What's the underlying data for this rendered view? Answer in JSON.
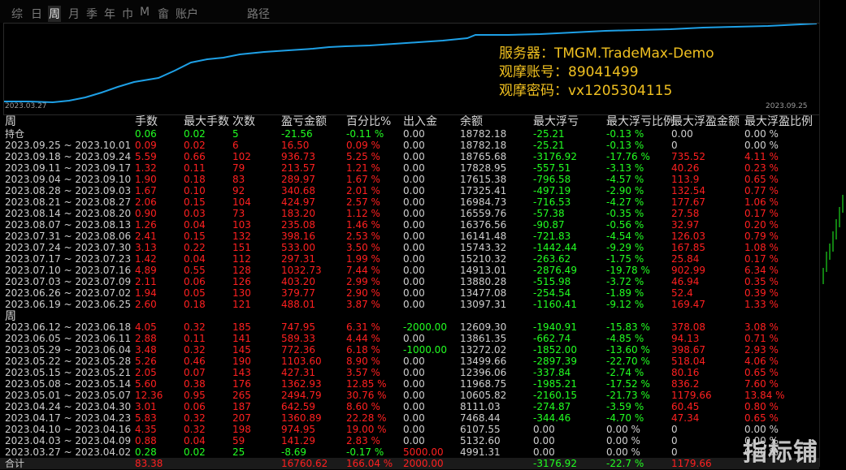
{
  "tabs": [
    {
      "label": "综",
      "active": false
    },
    {
      "label": "日",
      "active": false
    },
    {
      "label": "周",
      "active": true
    },
    {
      "label": "月",
      "active": false
    },
    {
      "label": "季",
      "active": false
    },
    {
      "label": "年",
      "active": false
    },
    {
      "label": "巾",
      "active": false
    },
    {
      "label": "M",
      "active": false
    },
    {
      "label": "畲",
      "active": false
    },
    {
      "label": "账户",
      "active": false
    },
    {
      "label": "路径",
      "active": false
    }
  ],
  "info": {
    "server": "服务器：TMGM.TradeMax-Demo",
    "account": "观摩账号：89041499",
    "password": "观摩密码：vx1205304115"
  },
  "curve": {
    "start_date": "2023.03.27",
    "end_date": "2023.09.25"
  },
  "headers": [
    "周",
    "手数",
    "最大手数",
    "次数",
    "盈亏金额",
    "百分比%",
    "出入金",
    "余额",
    "最大浮亏",
    "最大浮亏比例",
    "最大浮盈金额",
    "最大浮盈比例"
  ],
  "position_row": {
    "label": "持仓",
    "lots": "0.06",
    "max_lots": "0.02",
    "count": "5",
    "pnl": "-21.56",
    "pct": "-0.11 %",
    "inout": "0.00",
    "balance": "18782.18",
    "max_dd": "-25.21",
    "max_dd_pct": "-0.13 %",
    "max_fp": "0.00",
    "max_fp_pct": "0.00 %"
  },
  "rows": [
    {
      "period": "2023.09.25 ~ 2023.10.01",
      "lots": "0.09",
      "max_lots": "0.02",
      "count": "6",
      "pnl": "16.50",
      "pct": "0.09 %",
      "inout": "0.00",
      "balance": "18782.18",
      "max_dd": "-25.21",
      "max_dd_pct": "-0.13 %",
      "max_fp": "0",
      "max_fp_pct": "0.00 %"
    },
    {
      "period": "2023.09.18 ~ 2023.09.24",
      "lots": "5.59",
      "max_lots": "0.66",
      "count": "102",
      "pnl": "936.73",
      "pct": "5.25 %",
      "inout": "0.00",
      "balance": "18765.68",
      "max_dd": "-3176.92",
      "max_dd_pct": "-17.76 %",
      "max_fp": "735.52",
      "max_fp_pct": "4.11 %"
    },
    {
      "period": "2023.09.11 ~ 2023.09.17",
      "lots": "1.32",
      "max_lots": "0.11",
      "count": "79",
      "pnl": "213.57",
      "pct": "1.21 %",
      "inout": "0.00",
      "balance": "17828.95",
      "max_dd": "-557.51",
      "max_dd_pct": "-3.13 %",
      "max_fp": "40.26",
      "max_fp_pct": "0.23 %"
    },
    {
      "period": "2023.09.04 ~ 2023.09.10",
      "lots": "1.90",
      "max_lots": "0.18",
      "count": "83",
      "pnl": "289.97",
      "pct": "1.67 %",
      "inout": "0.00",
      "balance": "17615.38",
      "max_dd": "-796.58",
      "max_dd_pct": "-4.57 %",
      "max_fp": "113.9",
      "max_fp_pct": "0.65 %"
    },
    {
      "period": "2023.08.28 ~ 2023.09.03",
      "lots": "1.67",
      "max_lots": "0.10",
      "count": "92",
      "pnl": "340.68",
      "pct": "2.01 %",
      "inout": "0.00",
      "balance": "17325.41",
      "max_dd": "-497.19",
      "max_dd_pct": "-2.90 %",
      "max_fp": "132.54",
      "max_fp_pct": "0.77 %"
    },
    {
      "period": "2023.08.21 ~ 2023.08.27",
      "lots": "2.06",
      "max_lots": "0.15",
      "count": "104",
      "pnl": "424.97",
      "pct": "2.57 %",
      "inout": "0.00",
      "balance": "16984.73",
      "max_dd": "-716.53",
      "max_dd_pct": "-4.27 %",
      "max_fp": "177.67",
      "max_fp_pct": "1.06 %"
    },
    {
      "period": "2023.08.14 ~ 2023.08.20",
      "lots": "0.90",
      "max_lots": "0.03",
      "count": "73",
      "pnl": "183.20",
      "pct": "1.12 %",
      "inout": "0.00",
      "balance": "16559.76",
      "max_dd": "-57.38",
      "max_dd_pct": "-0.35 %",
      "max_fp": "27.58",
      "max_fp_pct": "0.17 %"
    },
    {
      "period": "2023.08.07 ~ 2023.08.13",
      "lots": "1.26",
      "max_lots": "0.04",
      "count": "103",
      "pnl": "235.08",
      "pct": "1.46 %",
      "inout": "0.00",
      "balance": "16376.56",
      "max_dd": "-90.87",
      "max_dd_pct": "-0.56 %",
      "max_fp": "32.97",
      "max_fp_pct": "0.20 %"
    },
    {
      "period": "2023.07.31 ~ 2023.08.06",
      "lots": "2.41",
      "max_lots": "0.15",
      "count": "132",
      "pnl": "398.16",
      "pct": "2.53 %",
      "inout": "0.00",
      "balance": "16141.48",
      "max_dd": "-721.83",
      "max_dd_pct": "-4.54 %",
      "max_fp": "126.03",
      "max_fp_pct": "0.79 %"
    },
    {
      "period": "2023.07.24 ~ 2023.07.30",
      "lots": "3.13",
      "max_lots": "0.22",
      "count": "151",
      "pnl": "533.00",
      "pct": "3.50 %",
      "inout": "0.00",
      "balance": "15743.32",
      "max_dd": "-1442.44",
      "max_dd_pct": "-9.29 %",
      "max_fp": "167.85",
      "max_fp_pct": "1.08 %"
    },
    {
      "period": "2023.07.17 ~ 2023.07.23",
      "lots": "1.42",
      "max_lots": "0.04",
      "count": "112",
      "pnl": "297.31",
      "pct": "1.99 %",
      "inout": "0.00",
      "balance": "15210.32",
      "max_dd": "-263.62",
      "max_dd_pct": "-1.75 %",
      "max_fp": "25.84",
      "max_fp_pct": "0.17 %"
    },
    {
      "period": "2023.07.10 ~ 2023.07.16",
      "lots": "4.89",
      "max_lots": "0.55",
      "count": "128",
      "pnl": "1032.73",
      "pct": "7.44 %",
      "inout": "0.00",
      "balance": "14913.01",
      "max_dd": "-2876.49",
      "max_dd_pct": "-19.78 %",
      "max_fp": "902.99",
      "max_fp_pct": "6.34 %"
    },
    {
      "period": "2023.07.03 ~ 2023.07.09",
      "lots": "2.11",
      "max_lots": "0.06",
      "count": "126",
      "pnl": "403.20",
      "pct": "2.99 %",
      "inout": "0.00",
      "balance": "13880.28",
      "max_dd": "-515.98",
      "max_dd_pct": "-3.72 %",
      "max_fp": "46.94",
      "max_fp_pct": "0.35 %"
    },
    {
      "period": "2023.06.26 ~ 2023.07.02",
      "lots": "1.94",
      "max_lots": "0.05",
      "count": "130",
      "pnl": "379.77",
      "pct": "2.90 %",
      "inout": "0.00",
      "balance": "13477.08",
      "max_dd": "-254.54",
      "max_dd_pct": "-1.89 %",
      "max_fp": "52.4",
      "max_fp_pct": "0.39 %"
    },
    {
      "period": "2023.06.19 ~ 2023.06.25",
      "lots": "2.60",
      "max_lots": "0.18",
      "count": "121",
      "pnl": "488.01",
      "pct": "3.87 %",
      "inout": "0.00",
      "balance": "13097.31",
      "max_dd": "-1160.41",
      "max_dd_pct": "-9.12 %",
      "max_fp": "169.47",
      "max_fp_pct": "1.33 %"
    },
    {
      "period": "2023.06.12 ~ 2023.06.18",
      "lots": "4.05",
      "max_lots": "0.32",
      "count": "185",
      "pnl": "747.95",
      "pct": "6.31 %",
      "inout": "-2000.00",
      "balance": "12609.30",
      "max_dd": "-1940.91",
      "max_dd_pct": "-15.83 %",
      "max_fp": "378.08",
      "max_fp_pct": "3.08 %"
    },
    {
      "period": "2023.06.05 ~ 2023.06.11",
      "lots": "2.88",
      "max_lots": "0.11",
      "count": "141",
      "pnl": "589.33",
      "pct": "4.44 %",
      "inout": "0.00",
      "balance": "13861.35",
      "max_dd": "-662.74",
      "max_dd_pct": "-4.85 %",
      "max_fp": "94.13",
      "max_fp_pct": "0.71 %"
    },
    {
      "period": "2023.05.29 ~ 2023.06.04",
      "lots": "3.48",
      "max_lots": "0.32",
      "count": "145",
      "pnl": "772.36",
      "pct": "6.18 %",
      "inout": "-1000.00",
      "balance": "13272.02",
      "max_dd": "-1852.00",
      "max_dd_pct": "-13.60 %",
      "max_fp": "398.67",
      "max_fp_pct": "2.93 %"
    },
    {
      "period": "2023.05.22 ~ 2023.05.28",
      "lots": "5.26",
      "max_lots": "0.46",
      "count": "190",
      "pnl": "1103.60",
      "pct": "8.90 %",
      "inout": "0.00",
      "balance": "13499.66",
      "max_dd": "-2897.39",
      "max_dd_pct": "-22.70 %",
      "max_fp": "518.04",
      "max_fp_pct": "4.06 %"
    },
    {
      "period": "2023.05.15 ~ 2023.05.21",
      "lots": "2.05",
      "max_lots": "0.07",
      "count": "143",
      "pnl": "427.31",
      "pct": "3.57 %",
      "inout": "0.00",
      "balance": "12396.06",
      "max_dd": "-337.84",
      "max_dd_pct": "-2.74 %",
      "max_fp": "80.16",
      "max_fp_pct": "0.65 %"
    },
    {
      "period": "2023.05.08 ~ 2023.05.14",
      "lots": "5.60",
      "max_lots": "0.38",
      "count": "176",
      "pnl": "1362.93",
      "pct": "12.85 %",
      "inout": "0.00",
      "balance": "11968.75",
      "max_dd": "-1985.21",
      "max_dd_pct": "-17.52 %",
      "max_fp": "836.2",
      "max_fp_pct": "7.60 %"
    },
    {
      "period": "2023.05.01 ~ 2023.05.07",
      "lots": "12.36",
      "max_lots": "0.95",
      "count": "265",
      "pnl": "2494.79",
      "pct": "30.76 %",
      "inout": "0.00",
      "balance": "10605.82",
      "max_dd": "-2160.15",
      "max_dd_pct": "-21.73 %",
      "max_fp": "1179.66",
      "max_fp_pct": "13.84 %"
    },
    {
      "period": "2023.04.24 ~ 2023.04.30",
      "lots": "3.01",
      "max_lots": "0.06",
      "count": "187",
      "pnl": "642.59",
      "pct": "8.60 %",
      "inout": "0.00",
      "balance": "8111.03",
      "max_dd": "-274.87",
      "max_dd_pct": "-3.59 %",
      "max_fp": "60.45",
      "max_fp_pct": "0.80 %"
    },
    {
      "period": "2023.04.17 ~ 2023.04.23",
      "lots": "5.83",
      "max_lots": "0.32",
      "count": "207",
      "pnl": "1360.89",
      "pct": "22.28 %",
      "inout": "0.00",
      "balance": "7468.44",
      "max_dd": "-344.46",
      "max_dd_pct": "-4.70 %",
      "max_fp": "47.34",
      "max_fp_pct": "0.65 %"
    },
    {
      "period": "2023.04.10 ~ 2023.04.16",
      "lots": "4.35",
      "max_lots": "0.32",
      "count": "198",
      "pnl": "974.95",
      "pct": "19.00 %",
      "inout": "0.00",
      "balance": "6107.55",
      "max_dd": "0.00",
      "max_dd_pct": "0.00 %",
      "max_fp": "0",
      "max_fp_pct": "0.00 %"
    },
    {
      "period": "2023.04.03 ~ 2023.04.09",
      "lots": "0.88",
      "max_lots": "0.04",
      "count": "59",
      "pnl": "141.29",
      "pct": "2.83 %",
      "inout": "0.00",
      "balance": "5132.60",
      "max_dd": "0.00",
      "max_dd_pct": "0.00 %",
      "max_fp": "0",
      "max_fp_pct": "0.00 %"
    },
    {
      "period": "2023.03.27 ~ 2023.04.02",
      "lots": "0.28",
      "max_lots": "0.02",
      "count": "25",
      "pnl": "-8.69",
      "pct": "-0.17 %",
      "inout": "5000.00",
      "balance": "4991.31",
      "max_dd": "0.00",
      "max_dd_pct": "0.00 %",
      "max_fp": "0",
      "max_fp_pct": "0.00 %"
    }
  ],
  "section_header": "周",
  "total_row": {
    "label": "合计",
    "lots": "83.38",
    "pnl": "16760.62",
    "pct": "166.04 %",
    "inout": "2000.00",
    "max_dd": "-3176.92",
    "max_dd_pct": "-22.7 %",
    "max_fp": "1179.66"
  },
  "watermark": "指标铺",
  "colors": {
    "curve": "#1ea0e6",
    "profit": "#ff2020",
    "loss": "#22ff22",
    "text": "#cfcfcf",
    "info": "#f0c020"
  }
}
